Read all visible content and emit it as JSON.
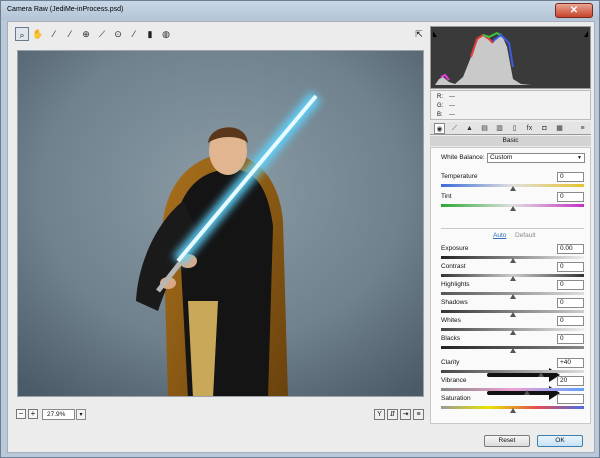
{
  "window": {
    "title": "Camera Raw (JediMe-inProcess.psd)",
    "close_glyph": "✕"
  },
  "toolbar": {
    "tools": [
      "zoom-tool",
      "hand-tool",
      "white-balance-tool",
      "color-sampler-tool",
      "targeted-adjustment-tool",
      "straighten-tool",
      "red-eye-tool",
      "brush-tool",
      "gradient-tool",
      "radial-filter-tool"
    ],
    "open_preferences_glyph": "⇱"
  },
  "preview": {
    "zoom_value": "27.9%",
    "zoom_minus": "−",
    "zoom_plus": "+"
  },
  "info": {
    "r_label": "R:",
    "r_value": "---",
    "g_label": "G:",
    "g_value": "---",
    "b_label": "B:",
    "b_value": "---"
  },
  "panel": {
    "title": "Basic",
    "white_balance_label": "White Balance:",
    "white_balance_value": "Custom",
    "auto_label": "Auto",
    "default_label": "Default",
    "sliders": [
      {
        "label": "Temperature",
        "value": "0",
        "level": 0.5
      },
      {
        "label": "Tint",
        "value": "0",
        "level": 0.5
      },
      {
        "label": "Exposure",
        "value": "0.00",
        "level": 0.5
      },
      {
        "label": "Contrast",
        "value": "0",
        "level": 0.5
      },
      {
        "label": "Highlights",
        "value": "0",
        "level": 0.5
      },
      {
        "label": "Shadows",
        "value": "0",
        "level": 0.5
      },
      {
        "label": "Whites",
        "value": "0",
        "level": 0.5
      },
      {
        "label": "Blacks",
        "value": "0",
        "level": 0.5
      },
      {
        "label": "Clarity",
        "value": "+40",
        "level": 0.7
      },
      {
        "label": "Vibrance",
        "value": "20",
        "level": 0.6
      },
      {
        "label": "Saturation",
        "value": "",
        "level": 0.5
      }
    ]
  },
  "buttons": {
    "reset": "Reset",
    "ok": "OK"
  },
  "colors": {
    "accent": "#2f6fb1",
    "window_frame": "#b9c9da",
    "saber_glow": "#5fd4ff"
  }
}
